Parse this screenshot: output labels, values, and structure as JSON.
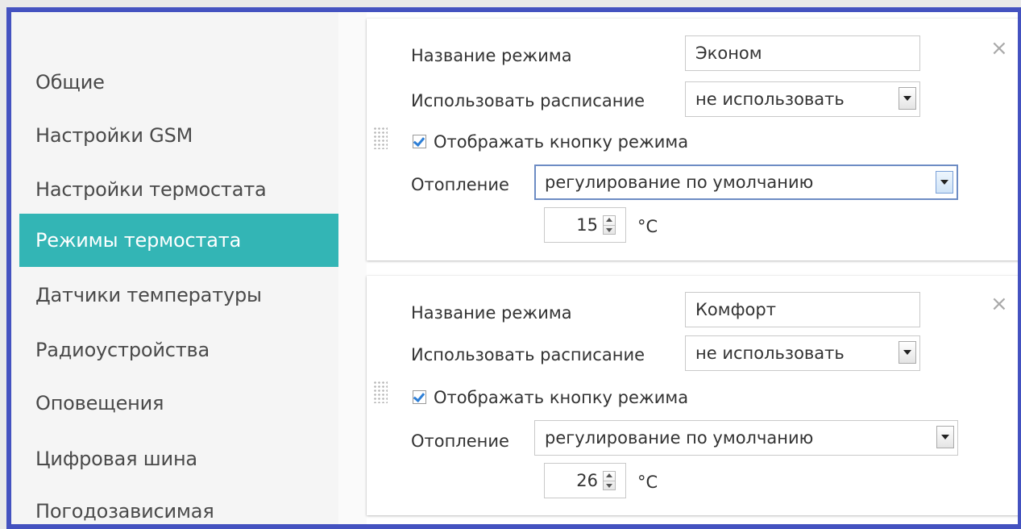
{
  "sidebar": {
    "items": [
      {
        "label": "Общие"
      },
      {
        "label": "Настройки GSM"
      },
      {
        "label": "Настройки термостата"
      },
      {
        "label": "Режимы термостата"
      },
      {
        "label": "Датчики температуры"
      },
      {
        "label": "Радиоустройства"
      },
      {
        "label": "Оповещения"
      },
      {
        "label": "Цифровая шина"
      },
      {
        "label": "Погодозависимая"
      }
    ],
    "active_index": 3
  },
  "modes": [
    {
      "name_label": "Название режима",
      "name_value": "Эконом",
      "schedule_label": "Использовать расписание",
      "schedule_value": "не использовать",
      "show_button_label": "Отображать кнопку режима",
      "show_button_checked": true,
      "heating_label": "Отопление",
      "heating_value": "регулирование по умолчанию",
      "temperature": "15",
      "unit": "°C",
      "close_symbol": "×"
    },
    {
      "name_label": "Название режима",
      "name_value": "Комфорт",
      "schedule_label": "Использовать расписание",
      "schedule_value": "не использовать",
      "show_button_label": "Отображать кнопку режима",
      "show_button_checked": true,
      "heating_label": "Отопление",
      "heating_value": "регулирование по умолчанию",
      "temperature": "26",
      "unit": "°C",
      "close_symbol": "×"
    }
  ],
  "colors": {
    "accent": "#33b5b5",
    "frame": "#4452c0"
  }
}
